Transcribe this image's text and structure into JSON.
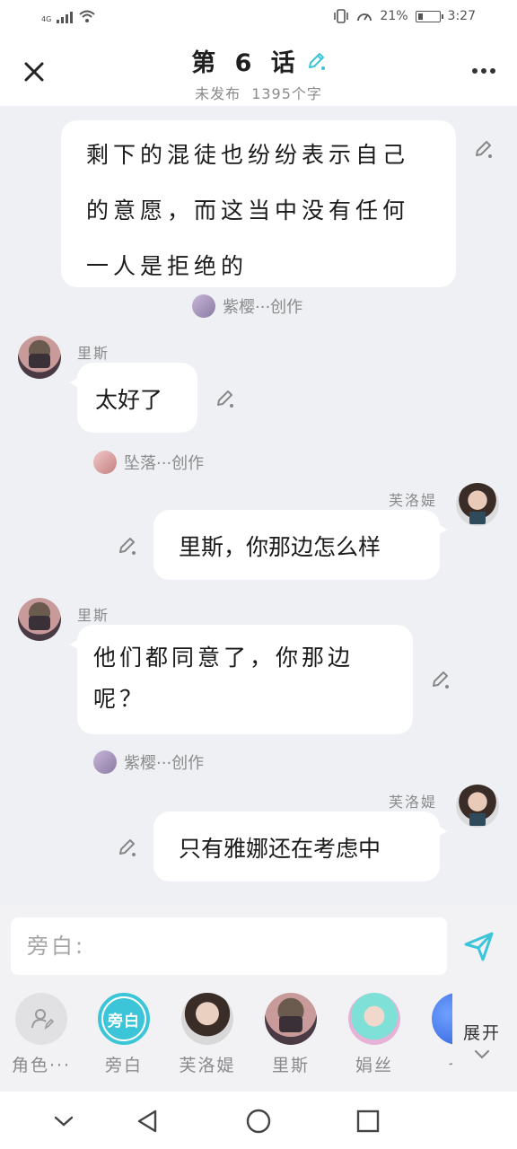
{
  "status_bar": {
    "network": "4G",
    "battery": "21%",
    "battery_level": 0.21,
    "time": "3:27"
  },
  "header": {
    "title": "第 6 话",
    "status": "未发布",
    "word_count": "1395个字"
  },
  "messages": [
    {
      "type": "narration",
      "text": "剩下的混徒也纷纷表示自己的意愿，而这当中没有任何一人是拒绝的",
      "credit": "紫樱···创作"
    },
    {
      "type": "left",
      "speaker": "里斯",
      "text": "太好了",
      "credit": "坠落···创作"
    },
    {
      "type": "right",
      "speaker": "芙洛媞",
      "text": "里斯，你那边怎么样"
    },
    {
      "type": "left",
      "speaker": "里斯",
      "text": "他们都同意了，你那边呢？",
      "credit": "紫樱···创作"
    },
    {
      "type": "right",
      "speaker": "芙洛媞",
      "text": "只有雅娜还在考虑中"
    }
  ],
  "input": {
    "placeholder": "旁白:"
  },
  "roles": [
    {
      "label": "角色···",
      "icon": "add-role-icon"
    },
    {
      "label": "旁白",
      "badge": "旁白",
      "selected": true
    },
    {
      "label": "芙洛媞"
    },
    {
      "label": "里斯"
    },
    {
      "label": "娟丝"
    },
    {
      "label": "七"
    }
  ],
  "expand_label": "展开",
  "colors": {
    "accent": "#3cc5d8",
    "chat_bg": "#eef0f4"
  }
}
